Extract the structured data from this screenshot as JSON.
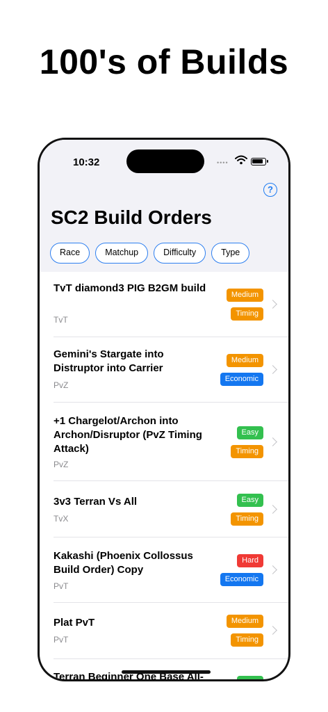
{
  "headline": "100's of Builds",
  "status": {
    "time": "10:32"
  },
  "app": {
    "title": "SC2 Build Orders",
    "help_label": "?"
  },
  "filters": [
    "Race",
    "Matchup",
    "Difficulty",
    "Type"
  ],
  "colors": {
    "orange": "#f39400",
    "blue": "#1477f0",
    "green": "#33c04f",
    "red": "#f03a35"
  },
  "builds": [
    {
      "title": "TvT diamond3 PIG B2GM build",
      "matchup": "TvT",
      "badges": [
        {
          "label": "Medium",
          "color": "orange"
        },
        {
          "label": "Timing",
          "color": "orange"
        }
      ]
    },
    {
      "title": "Gemini's Stargate into Distruptor into Carrier",
      "matchup": "PvZ",
      "badges": [
        {
          "label": "Medium",
          "color": "orange"
        },
        {
          "label": "Economic",
          "color": "blue"
        }
      ]
    },
    {
      "title": "+1 Chargelot/Archon into Archon/Disruptor (PvZ Timing Attack)",
      "matchup": "PvZ",
      "badges": [
        {
          "label": "Easy",
          "color": "green"
        },
        {
          "label": "Timing",
          "color": "orange"
        }
      ]
    },
    {
      "title": "3v3 Terran Vs All",
      "matchup": "TvX",
      "badges": [
        {
          "label": "Easy",
          "color": "green"
        },
        {
          "label": "Timing",
          "color": "orange"
        }
      ]
    },
    {
      "title": "Kakashi (Phoenix Collossus Build Order) Copy",
      "matchup": "PvT",
      "badges": [
        {
          "label": "Hard",
          "color": "red"
        },
        {
          "label": "Economic",
          "color": "blue"
        }
      ]
    },
    {
      "title": "Plat PvT",
      "matchup": "PvT",
      "badges": [
        {
          "label": "Medium",
          "color": "orange"
        },
        {
          "label": "Timing",
          "color": "orange"
        }
      ]
    },
    {
      "title": "Terran Beginner One Base All-",
      "matchup": "",
      "badges": [
        {
          "label": "",
          "color": "green"
        }
      ]
    }
  ]
}
